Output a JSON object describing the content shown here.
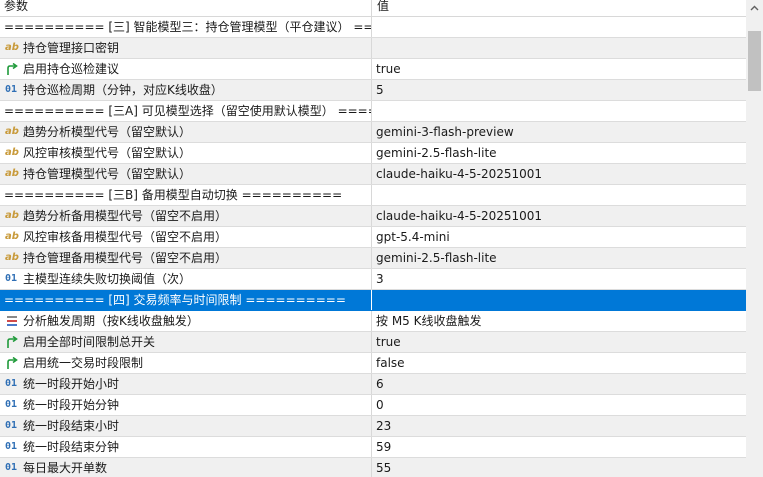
{
  "header": {
    "col_name": "参数",
    "col_value": "值"
  },
  "rows": [
    {
      "type": "sep",
      "label": "========== [三] 智能模型三：持仓管理模型（平仓建议） ==========",
      "value": ""
    },
    {
      "type": "ab",
      "label": "持仓管理接口密钥",
      "value": ""
    },
    {
      "type": "bool",
      "label": "启用持仓巡检建议",
      "value": "true"
    },
    {
      "type": "num",
      "label": "持仓巡检周期（分钟，对应K线收盘）",
      "value": "5"
    },
    {
      "type": "sep",
      "label": "========== [三A] 可见模型选择（留空使用默认模型） ==========",
      "value": ""
    },
    {
      "type": "ab",
      "label": "趋势分析模型代号（留空默认）",
      "value": "gemini-3-flash-preview"
    },
    {
      "type": "ab",
      "label": "风控审核模型代号（留空默认）",
      "value": "gemini-2.5-flash-lite"
    },
    {
      "type": "ab",
      "label": "持仓管理模型代号（留空默认）",
      "value": "claude-haiku-4-5-20251001"
    },
    {
      "type": "sep",
      "label": "========== [三B] 备用模型自动切换 ==========",
      "value": ""
    },
    {
      "type": "ab",
      "label": "趋势分析备用模型代号（留空不启用）",
      "value": "claude-haiku-4-5-20251001"
    },
    {
      "type": "ab",
      "label": "风控审核备用模型代号（留空不启用）",
      "value": "gpt-5.4-mini"
    },
    {
      "type": "ab",
      "label": "持仓管理备用模型代号（留空不启用）",
      "value": "gemini-2.5-flash-lite"
    },
    {
      "type": "num",
      "label": "主模型连续失败切换阈值（次）",
      "value": "3"
    },
    {
      "type": "sep",
      "label": "========== [四] 交易频率与时间限制 ==========",
      "value": "",
      "selected": true
    },
    {
      "type": "enum",
      "label": "分析触发周期（按K线收盘触发）",
      "value": "按 M5 K线收盘触发"
    },
    {
      "type": "bool",
      "label": "启用全部时间限制总开关",
      "value": "true"
    },
    {
      "type": "bool",
      "label": "启用统一交易时段限制",
      "value": "false"
    },
    {
      "type": "num",
      "label": "统一时段开始小时",
      "value": "6"
    },
    {
      "type": "num",
      "label": "统一时段开始分钟",
      "value": "0"
    },
    {
      "type": "num",
      "label": "统一时段结束小时",
      "value": "23"
    },
    {
      "type": "num",
      "label": "统一时段结束分钟",
      "value": "59"
    },
    {
      "type": "num",
      "label": "每日最大开单数",
      "value": "55"
    }
  ],
  "icons": {
    "ab": "ab",
    "num": "01",
    "bool": "toggle-arrow-icon",
    "enum": "list-icon"
  },
  "colors": {
    "selected": "#0078d7",
    "ab_icon": "#c89a3a",
    "num_icon": "#2f6fb5",
    "bool_icon": "#1f9a3a"
  }
}
